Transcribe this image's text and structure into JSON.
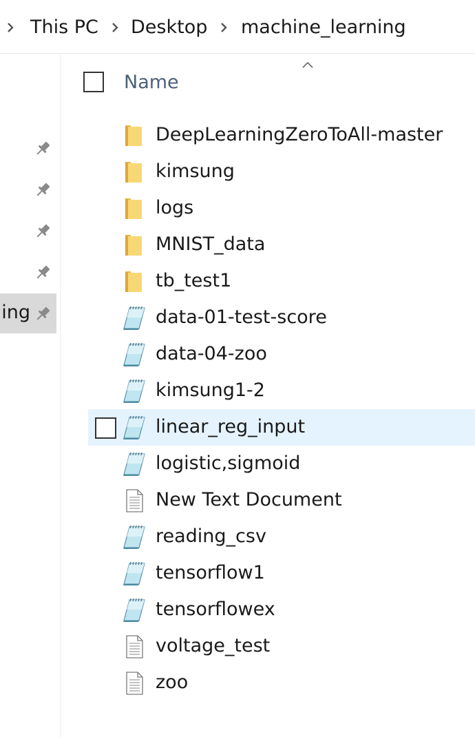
{
  "breadcrumb": {
    "items": [
      {
        "label": "This PC"
      },
      {
        "label": "Desktop"
      },
      {
        "label": "machine_learning"
      }
    ]
  },
  "nav_pane": {
    "pinned_count": 5,
    "selected_item_partial_label": "ning"
  },
  "file_list": {
    "column_header": "Name",
    "sort": "ascending",
    "selected_index": 8,
    "items": [
      {
        "name": "DeepLearningZeroToAll-master",
        "type": "folder"
      },
      {
        "name": "kimsung",
        "type": "folder"
      },
      {
        "name": "logs",
        "type": "folder"
      },
      {
        "name": "MNIST_data",
        "type": "folder"
      },
      {
        "name": "tb_test1",
        "type": "folder"
      },
      {
        "name": "data-01-test-score",
        "type": "notepad"
      },
      {
        "name": "data-04-zoo",
        "type": "notepad"
      },
      {
        "name": "kimsung1-2",
        "type": "notepad"
      },
      {
        "name": "linear_reg_input",
        "type": "notepad"
      },
      {
        "name": "logistic,sigmoid",
        "type": "notepad"
      },
      {
        "name": "New Text Document",
        "type": "text"
      },
      {
        "name": "reading_csv",
        "type": "notepad"
      },
      {
        "name": "tensorflow1",
        "type": "notepad"
      },
      {
        "name": "tensorflowex",
        "type": "notepad"
      },
      {
        "name": "voltage_test",
        "type": "text"
      },
      {
        "name": "zoo",
        "type": "text"
      }
    ]
  },
  "colors": {
    "selection_bg": "#e5f3ff",
    "nav_selected_bg": "#d9d9d9",
    "header_text": "#4c607a",
    "folder_yellow": "#f8d775"
  }
}
